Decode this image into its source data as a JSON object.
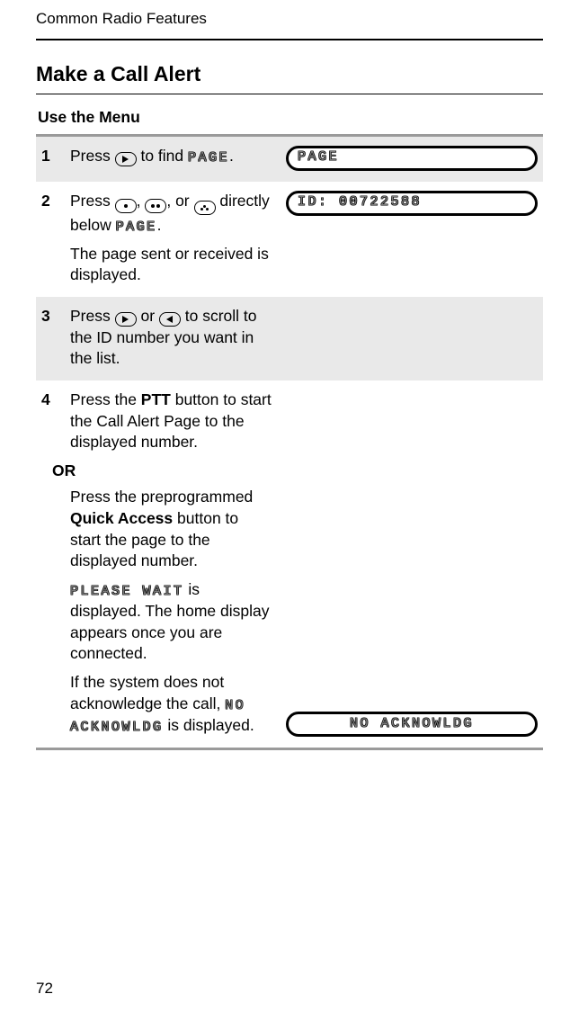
{
  "runningHead": "Common Radio Features",
  "sectionTitle": "Make a Call Alert",
  "subsection": "Use the Menu",
  "lcdWords": {
    "page": "PAGE",
    "pleaseWait": "PLEASE WAIT",
    "noAck": "NO ACKNOWLDG"
  },
  "displays": {
    "step1": "PAGE",
    "step2": "ID: 00722588",
    "step4b": "NO ACKNOWLDG"
  },
  "steps": {
    "s1": {
      "num": "1",
      "pre": "Press ",
      "post1": " to find ",
      "post2": "."
    },
    "s2": {
      "num": "2",
      "t1a": "Press ",
      "t1b": ", ",
      "t1c": ", or ",
      "t1d": " directly below ",
      "t1e": ".",
      "t2": "The page sent or received is displayed."
    },
    "s3": {
      "num": "3",
      "a": "Press ",
      "b": " or ",
      "c": " to scroll to the ID number you want in the list."
    },
    "s4": {
      "num": "4",
      "p1a": "Press the ",
      "p1bold": "PTT",
      "p1b": " button to start the Call Alert Page to the displayed number.",
      "or": "OR",
      "p2a": "Press the preprogrammed ",
      "p2bold": "Quick Access",
      "p2b": " button to start the page to the displayed number.",
      "p3a": " is displayed. The home display appears once you are connected.",
      "p4a": "If the system does not acknowledge the call, ",
      "p4b": " is displayed."
    }
  },
  "pageNumber": "72"
}
